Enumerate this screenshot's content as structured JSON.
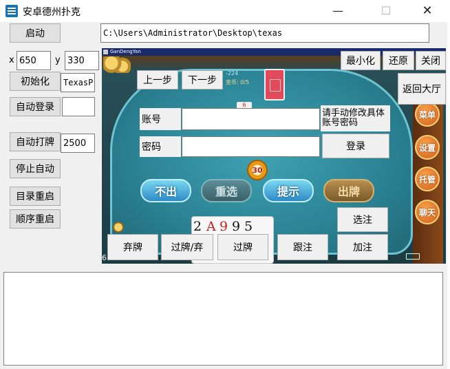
{
  "window": {
    "title": "安卓德州扑克",
    "min_glyph": "—",
    "max_glyph": "☐",
    "close_glyph": "✕"
  },
  "controls": {
    "start": "启动",
    "path": "C:\\Users\\Administrator\\Desktop\\texas",
    "x_label": "x",
    "x_value": "650",
    "y_label": "y",
    "y_value": "330",
    "init": "初始化",
    "init_value": "TexasP",
    "auto_login": "自动登录",
    "auto_login_value": "",
    "auto_play": "自动打牌",
    "auto_play_value": "2500",
    "stop_auto": "停止自动",
    "dir_restart": "目录重启",
    "seq_restart": "顺序重启"
  },
  "game": {
    "bar_title": "GanDengYan",
    "info_line1": "-224",
    "info_line2": "金币: 0/5",
    "small_card": "6",
    "clock": "30",
    "pills": [
      "不出",
      "重选",
      "提示",
      "出牌"
    ],
    "side_buttons": [
      "菜单",
      "设置",
      "托管",
      "聊天"
    ],
    "hand_cards": [
      "2",
      "A",
      "9",
      "9",
      "5"
    ],
    "left_num": "6"
  },
  "overlay": {
    "minimize": "最小化",
    "restore": "还原",
    "close": "关闭",
    "back_lobby": "返回大厅",
    "prev_step": "上一步",
    "next_step": "下一步",
    "account_label": "账号",
    "account_value": "",
    "password_label": "密码",
    "password_value": "",
    "hint": "请手动修改具体账号密码",
    "login": "登录",
    "select": "选注",
    "fold": "弃牌",
    "check_fold": "过牌/弃",
    "check": "过牌",
    "call": "跟注",
    "raise": "加注"
  },
  "log": {
    "text": ""
  },
  "colors": {
    "felt": "#2c8596",
    "button_face": "#e1e1e1",
    "window_bg": "#f0f0f0"
  }
}
